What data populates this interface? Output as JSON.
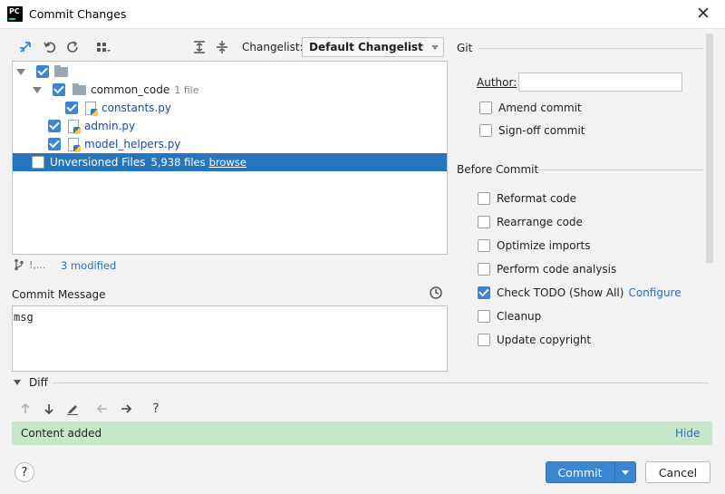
{
  "window": {
    "title": "Commit Changes",
    "app_icon_label": "PC"
  },
  "toolbar": {
    "changelist_label": "Changelist:",
    "changelist_value": "Default Changelist"
  },
  "tree": {
    "rows": [
      {
        "name": "common_code",
        "meta": "1 file"
      },
      {
        "name": "constants.py"
      },
      {
        "name": "admin.py"
      },
      {
        "name": "model_helpers.py"
      }
    ],
    "unversioned": {
      "label": "Unversioned Files",
      "count": "5,938 files",
      "link": "browse"
    }
  },
  "status": {
    "branch": "!,...",
    "modified": "3 modified"
  },
  "commit_message": {
    "label": "Commit Message",
    "value": "msg"
  },
  "git": {
    "heading": "Git",
    "author_label": "Author:",
    "author_value": "",
    "amend": "Amend commit",
    "signoff": "Sign-off commit"
  },
  "before_commit": {
    "heading": "Before Commit",
    "options": [
      {
        "label": "Reformat code",
        "checked": false
      },
      {
        "label": "Rearrange code",
        "checked": false
      },
      {
        "label": "Optimize imports",
        "checked": false
      },
      {
        "label": "Perform code analysis",
        "checked": false
      },
      {
        "label": "Check TODO (Show All)",
        "checked": true,
        "link": "Configure"
      },
      {
        "label": "Cleanup",
        "checked": false
      },
      {
        "label": "Update copyright",
        "checked": false
      }
    ]
  },
  "diff": {
    "heading": "Diff",
    "content_added": "Content added",
    "hide": "Hide"
  },
  "footer": {
    "help": "?",
    "commit": "Commit",
    "cancel": "Cancel"
  },
  "colors": {
    "accent": "#3c85d2",
    "selection": "#2675bf",
    "diff_added": "#c8e6c9",
    "link": "#2a6dc0"
  }
}
